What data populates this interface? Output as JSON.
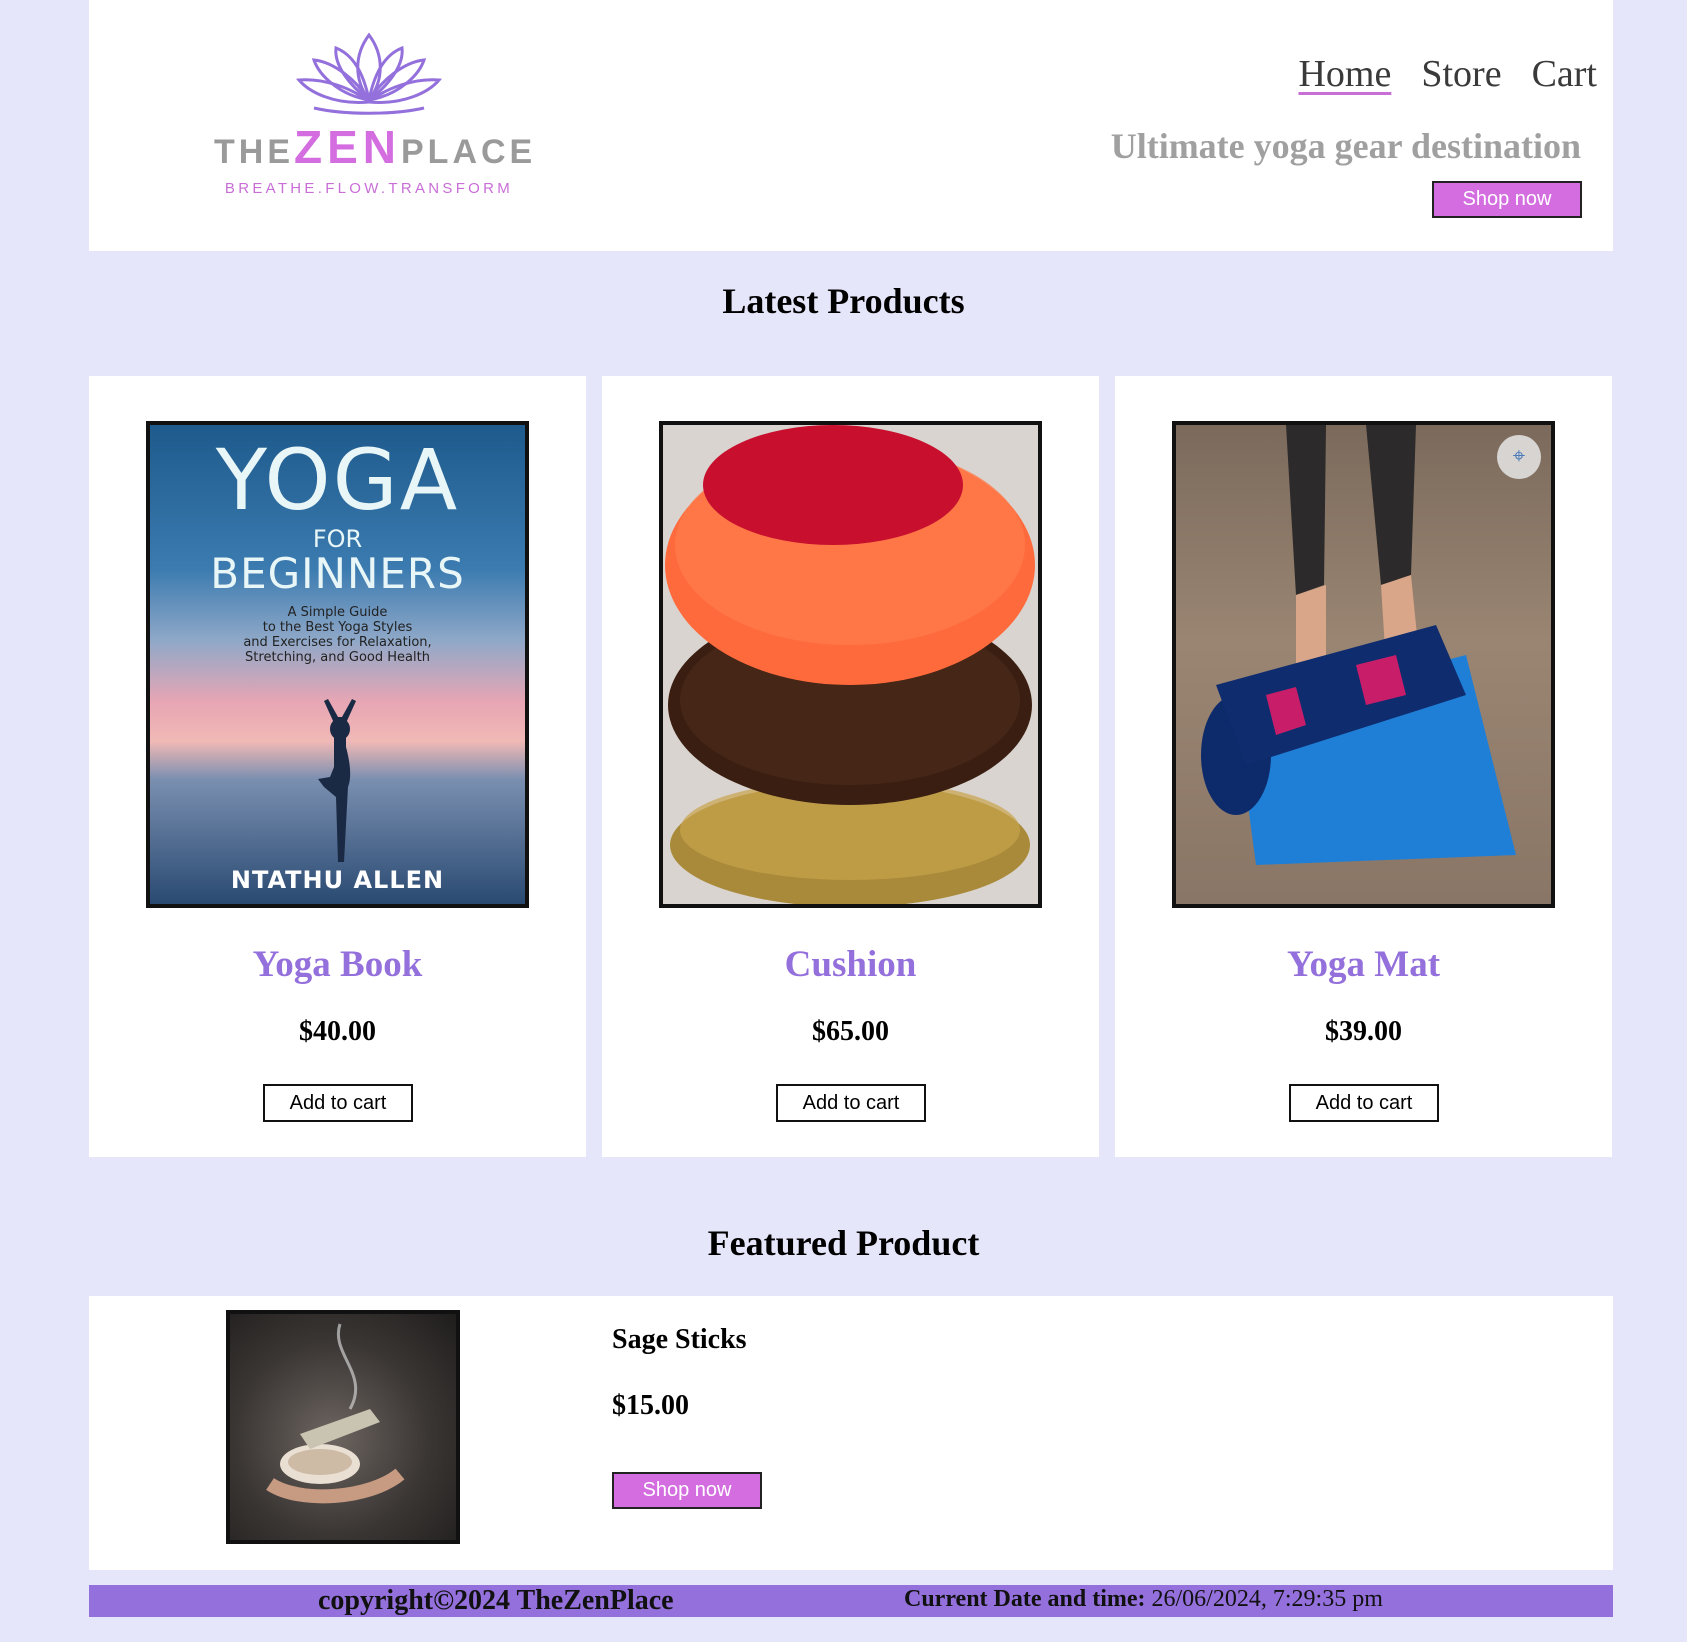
{
  "header": {
    "logo": {
      "the": "THE",
      "zen": "ZEN",
      "place": "PLACE",
      "tagline": "BREATHE.FLOW.TRANSFORM"
    },
    "nav": [
      "Home",
      "Store",
      "Cart"
    ],
    "tagline": "Ultimate yoga gear destination",
    "shop_button": "Shop now"
  },
  "latest": {
    "title": "Latest Products",
    "products": [
      {
        "name": "Yoga Book",
        "price": "$40.00",
        "button": "Add to cart",
        "cover": {
          "title1": "YOGA",
          "title2": "FOR",
          "title3": "BEGINNERS",
          "subtitle": [
            "A Simple Guide",
            "to the Best Yoga Styles",
            "and Exercises for Relaxation,",
            "Stretching, and Good Health"
          ],
          "author": "NTATHU ALLEN"
        }
      },
      {
        "name": "Cushion",
        "price": "$65.00",
        "button": "Add to cart"
      },
      {
        "name": "Yoga Mat",
        "price": "$39.00",
        "button": "Add to cart"
      }
    ]
  },
  "featured": {
    "title": "Featured Product",
    "name": "Sage Sticks",
    "price": "$15.00",
    "button": "Shop now"
  },
  "footer": {
    "copyright": "copyright©2024 TheZenPlace",
    "date_label": "Current Date and time:",
    "date_value": "26/06/2024, 7:29:35 pm"
  },
  "colors": {
    "background": "#e6e6fa",
    "accent_pink": "#d46ee0",
    "accent_purple": "#9370db"
  }
}
